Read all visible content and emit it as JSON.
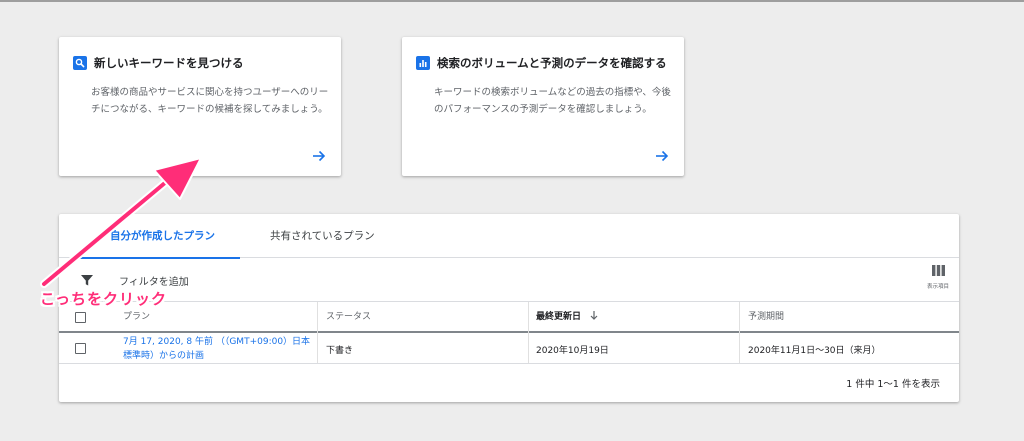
{
  "cards": {
    "find": {
      "icon": "search-icon",
      "title": "新しいキーワードを見つける",
      "desc": "お客様の商品やサービスに関心を持つユーザーへのリーチにつながる、キーワードの候補を探してみましょう。"
    },
    "forecast": {
      "icon": "bar-chart-icon",
      "title": "検索のボリュームと予測のデータを確認する",
      "desc": "キーワードの検索ボリュームなどの過去の指標や、今後のパフォーマンスの予測データを確認しましょう。"
    }
  },
  "tabs": {
    "mine": "自分が作成したプラン",
    "shared": "共有されているプラン"
  },
  "filter": {
    "label": "フィルタを追加",
    "columns_label": "表示項目"
  },
  "table": {
    "headers": {
      "plan": "プラン",
      "status": "ステータス",
      "updated": "最終更新日",
      "period": "予測期間"
    },
    "rows": [
      {
        "plan": "7月 17, 2020, 8 午前 （（GMT+09:00）日本標準時）からの計画",
        "status": "下書き",
        "updated": "2020年10月19日",
        "period": "2020年11月1日〜30日（来月）"
      }
    ]
  },
  "pagination": "1 件中 1〜1 件を表示",
  "annotation": {
    "text": "こっちをクリック",
    "color": "#ff2d78"
  },
  "colors": {
    "accent": "#1a73e8"
  }
}
